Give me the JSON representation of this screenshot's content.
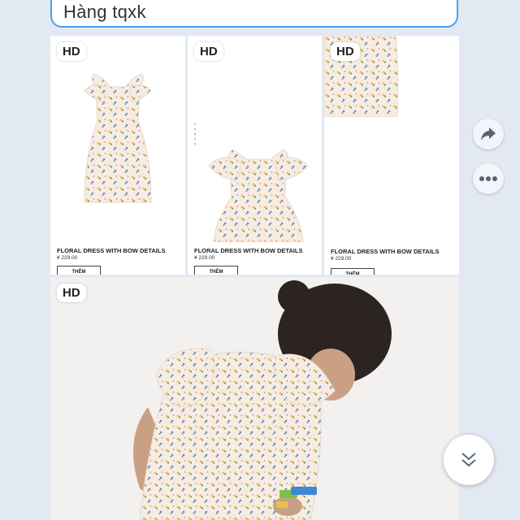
{
  "message": {
    "text": "Hàng tqxk"
  },
  "media": {
    "hd_label": "HD",
    "products": [
      {
        "name": "FLORAL DRESS WITH BOW DETAILS",
        "price": "¥ 229.00",
        "button": "THÊM"
      },
      {
        "name": "FLORAL DRESS WITH BOW DETAILS",
        "price": "¥ 229.00",
        "button": "THÊM"
      },
      {
        "name": "FLORAL DRESS WITH BOW DETAILS",
        "price": "¥ 229.00",
        "button": "THÊM"
      }
    ]
  },
  "actions": {
    "share_icon": "share-arrow-icon",
    "more_icon": "more-dots-icon",
    "scroll_icon": "double-chevron-down-icon"
  },
  "colors": {
    "background": "#e2e9f2",
    "bubble_border": "#4a9ff0",
    "dress_fabric": "#f7ebe4",
    "scroll_chevron": "#5a6a7a"
  }
}
